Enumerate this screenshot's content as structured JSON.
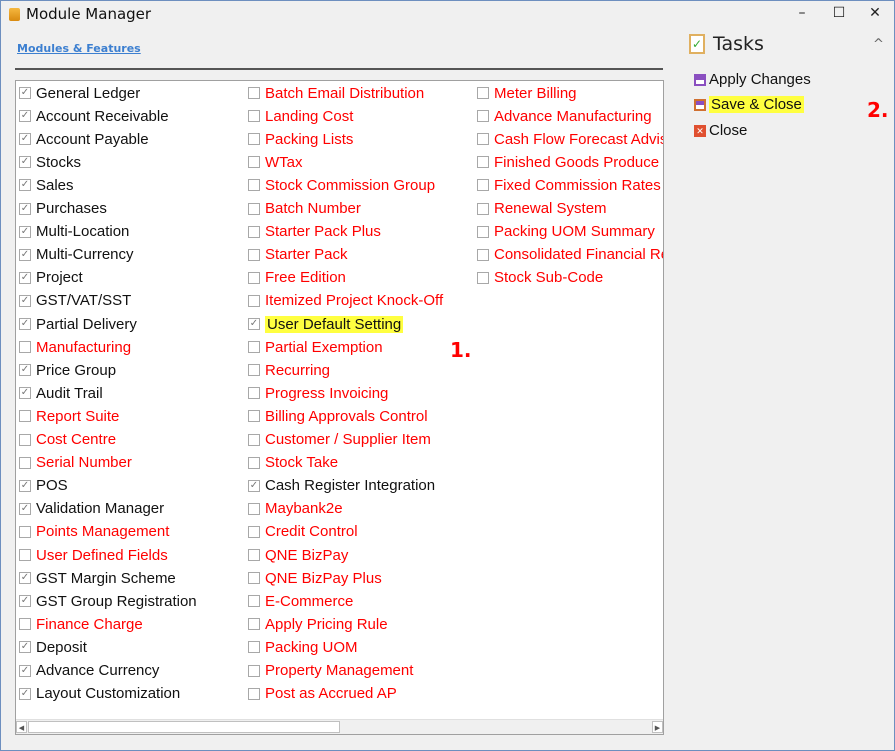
{
  "window": {
    "title": "Module Manager",
    "minimize": "–",
    "maximize": "☐",
    "close": "✕"
  },
  "section_link": "Modules & Features",
  "annotations": {
    "one": "1.",
    "two": "2."
  },
  "tasks": {
    "title": "Tasks",
    "collapse": "^",
    "items": [
      {
        "label": "Apply Changes",
        "icon": "save-icon",
        "highlighted": false
      },
      {
        "label": "Save & Close",
        "icon": "save-close-icon",
        "highlighted": true
      },
      {
        "label": "Close",
        "icon": "close-icon",
        "highlighted": false
      }
    ]
  },
  "colors": {
    "enabled": "#111111",
    "disabled": "#ff0000",
    "highlight": "#ffff40"
  },
  "columns": [
    [
      {
        "label": "General Ledger",
        "checked": true
      },
      {
        "label": "Account Receivable",
        "checked": true
      },
      {
        "label": "Account Payable",
        "checked": true
      },
      {
        "label": "Stocks",
        "checked": true
      },
      {
        "label": "Sales",
        "checked": true
      },
      {
        "label": "Purchases",
        "checked": true
      },
      {
        "label": "Multi-Location",
        "checked": true
      },
      {
        "label": "Multi-Currency",
        "checked": true
      },
      {
        "label": "Project",
        "checked": true
      },
      {
        "label": "GST/VAT/SST",
        "checked": true
      },
      {
        "label": "Partial Delivery",
        "checked": true
      },
      {
        "label": "Manufacturing",
        "checked": false
      },
      {
        "label": "Price Group",
        "checked": true
      },
      {
        "label": "Audit Trail",
        "checked": true
      },
      {
        "label": "Report Suite",
        "checked": false
      },
      {
        "label": "Cost Centre",
        "checked": false
      },
      {
        "label": "Serial Number",
        "checked": false
      },
      {
        "label": "POS",
        "checked": true
      },
      {
        "label": "Validation Manager",
        "checked": true
      },
      {
        "label": "Points Management",
        "checked": false
      },
      {
        "label": "User Defined Fields",
        "checked": false
      },
      {
        "label": "GST Margin Scheme",
        "checked": true
      },
      {
        "label": "GST Group Registration",
        "checked": true
      },
      {
        "label": "Finance Charge",
        "checked": false
      },
      {
        "label": "Deposit",
        "checked": true
      },
      {
        "label": "Advance Currency",
        "checked": true
      },
      {
        "label": "Layout Customization",
        "checked": true
      }
    ],
    [
      {
        "label": "Batch Email Distribution",
        "checked": false
      },
      {
        "label": "Landing Cost",
        "checked": false
      },
      {
        "label": "Packing Lists",
        "checked": false
      },
      {
        "label": "WTax",
        "checked": false
      },
      {
        "label": "Stock Commission Group",
        "checked": false
      },
      {
        "label": "Batch Number",
        "checked": false
      },
      {
        "label": "Starter Pack Plus",
        "checked": false
      },
      {
        "label": "Starter Pack",
        "checked": false
      },
      {
        "label": "Free Edition",
        "checked": false
      },
      {
        "label": "Itemized Project Knock-Off",
        "checked": false
      },
      {
        "label": "User Default Setting",
        "checked": true,
        "highlighted": true
      },
      {
        "label": "Partial Exemption",
        "checked": false
      },
      {
        "label": "Recurring",
        "checked": false
      },
      {
        "label": "Progress Invoicing",
        "checked": false
      },
      {
        "label": "Billing Approvals Control",
        "checked": false
      },
      {
        "label": "Customer / Supplier Item",
        "checked": false
      },
      {
        "label": "Stock Take",
        "checked": false
      },
      {
        "label": "Cash Register Integration",
        "checked": true
      },
      {
        "label": "Maybank2e",
        "checked": false
      },
      {
        "label": "Credit Control",
        "checked": false
      },
      {
        "label": "QNE BizPay",
        "checked": false
      },
      {
        "label": "QNE BizPay Plus",
        "checked": false
      },
      {
        "label": "E-Commerce",
        "checked": false
      },
      {
        "label": "Apply Pricing Rule",
        "checked": false
      },
      {
        "label": "Packing UOM",
        "checked": false
      },
      {
        "label": "Property Management",
        "checked": false
      },
      {
        "label": "Post as Accrued AP",
        "checked": false
      }
    ],
    [
      {
        "label": "Meter Billing",
        "checked": false
      },
      {
        "label": "Advance Manufacturing",
        "checked": false
      },
      {
        "label": "Cash Flow Forecast Advisor",
        "checked": false
      },
      {
        "label": "Finished Goods Produce",
        "checked": false
      },
      {
        "label": "Fixed Commission Rates",
        "checked": false
      },
      {
        "label": "Renewal System",
        "checked": false
      },
      {
        "label": "Packing UOM Summary",
        "checked": false
      },
      {
        "label": "Consolidated Financial Report",
        "checked": false
      },
      {
        "label": "Stock Sub-Code",
        "checked": false
      }
    ]
  ]
}
